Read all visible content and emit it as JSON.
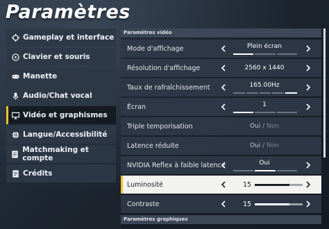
{
  "title": "Paramètres",
  "sidebar": {
    "items": [
      {
        "label": "Gameplay et interface",
        "icon": "crosshair-icon"
      },
      {
        "label": "Clavier et souris",
        "icon": "mouse-icon"
      },
      {
        "label": "Manette",
        "icon": "gamepad-icon"
      },
      {
        "label": "Audio/Chat vocal",
        "icon": "microphone-icon"
      },
      {
        "label": "Vidéo et graphismes",
        "icon": "monitor-icon"
      },
      {
        "label": "Langue/Accessibilité",
        "icon": "globe-icon"
      },
      {
        "label": "Matchmaking et compte",
        "icon": "document-icon"
      },
      {
        "label": "Crédits",
        "icon": "document-icon"
      }
    ],
    "active_index": 4
  },
  "video": {
    "section_title": "Paramètres vidéo",
    "display_mode": {
      "label": "Mode d'affichage",
      "value": "Plein écran",
      "segments": 3,
      "active_segment": 0
    },
    "resolution": {
      "label": "Résolution d'affichage",
      "value": "2560 x 1440"
    },
    "refresh_rate": {
      "label": "Taux de rafraîchissement",
      "value": "165.00Hz",
      "segments": 5,
      "active_segment": 4
    },
    "screen": {
      "label": "Écran",
      "value": "1",
      "segments": 3,
      "active_segment": 0
    },
    "triple_buffering": {
      "label": "Triple temporisation",
      "on": "Oui",
      "sep": "/",
      "off": "Non"
    },
    "reduced_latency": {
      "label": "Latence réduite",
      "on": "Oui",
      "sep": "/",
      "off": "Non"
    },
    "nvidia_reflex": {
      "label": "NVIDIA Reflex à faible latence",
      "value": "Oui",
      "segments": 3,
      "active_segment": 1
    },
    "brightness": {
      "label": "Luminosité",
      "value": "15",
      "fill_fraction": 0.72
    },
    "contrast": {
      "label": "Contraste",
      "value": "15",
      "fill_fraction": 0.72
    }
  },
  "next_section_title": "Paramètres graphiques",
  "colors": {
    "accent": "#f0c52a",
    "highlight_row": "#f2f2ee"
  }
}
